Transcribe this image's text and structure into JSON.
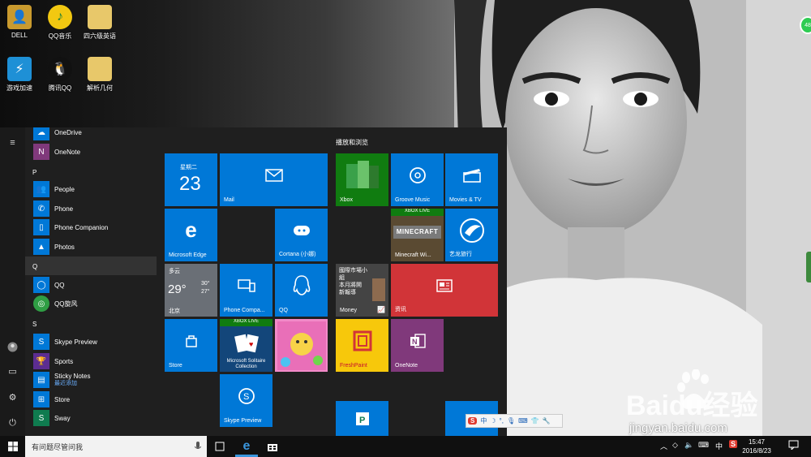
{
  "desktop": {
    "icons": [
      {
        "label": "DELL"
      },
      {
        "label": "QQ音乐"
      },
      {
        "label": "四六级英语"
      },
      {
        "label": "游戏加速"
      },
      {
        "label": "腾讯QQ"
      },
      {
        "label": "解析几何"
      }
    ],
    "badge": "48"
  },
  "start_menu": {
    "apps": [
      {
        "label": "OneDrive"
      },
      {
        "label": "OneNote"
      },
      {
        "label": "People"
      },
      {
        "label": "Phone"
      },
      {
        "label": "Phone Companion"
      },
      {
        "label": "Photos"
      },
      {
        "label": "QQ"
      },
      {
        "label": "QQ旋风"
      },
      {
        "label": "Skype Preview"
      },
      {
        "label": "Sports"
      },
      {
        "label": "Sticky Notes",
        "sub": "最近添加"
      },
      {
        "label": "Store"
      },
      {
        "label": "Sway"
      }
    ],
    "letters": [
      "P",
      "Q",
      "S"
    ],
    "group_title": "播放和浏览",
    "tiles": {
      "calendar": {
        "day_name": "星期二",
        "day": "23"
      },
      "mail": "Mail",
      "edge": "Microsoft Edge",
      "cortana": "Cortana (小娜)",
      "weather": {
        "condition": "多云",
        "temp": "29°",
        "high": "30°",
        "low": "27°",
        "city": "北京"
      },
      "phone_companion": "Phone Compa...",
      "qq": "QQ",
      "store": "Store",
      "solitaire": {
        "label": "Microsoft Solitaire Collection",
        "badge": "XBOX LIVE"
      },
      "candy": "",
      "skype": "Skype Preview",
      "xbox": "Xbox",
      "groove": "Groove Music",
      "movies": "Movies & TV",
      "minecraft": {
        "label": "Minecraft Wi...",
        "badge": "XBOX LIVE",
        "art": "MINECRAFT"
      },
      "elong": "艺龙旅行",
      "money": {
        "label": "Money",
        "headline": "國際市場小組\n本月將開\n新報導"
      },
      "news": "资讯",
      "freshpaint": "FreshPaint",
      "onenote": "OneNote"
    }
  },
  "taskbar": {
    "search_placeholder": "有问题尽管问我",
    "ime_indicator": "中",
    "clock_time": "15:47",
    "clock_date": "2016/8/23"
  },
  "ime_bar": {
    "mode": "中"
  },
  "watermark": {
    "brand": "Baidu经验",
    "url": "jingyan.baidu.com"
  },
  "colors": {
    "accent": "#0078d7",
    "news_red": "#d13438",
    "onenote_purple": "#80397b",
    "freshpaint_yellow": "#f7c80b"
  }
}
